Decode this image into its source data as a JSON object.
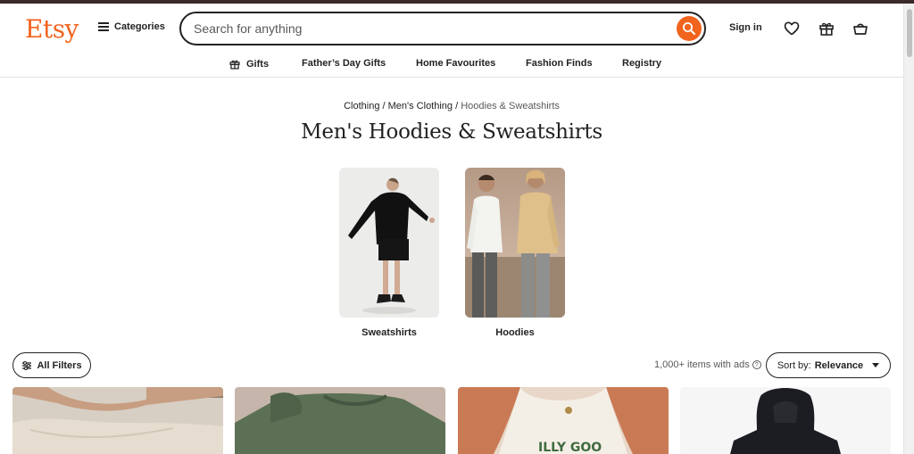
{
  "header": {
    "logo": "Etsy",
    "categories_label": "Categories",
    "search_placeholder": "Search for anything",
    "signin_label": "Sign in",
    "icons": [
      "search-icon",
      "heart-icon",
      "gift-icon",
      "bag-icon"
    ],
    "accent_color": "#f1641e"
  },
  "nav": {
    "items": [
      {
        "label": "Gifts",
        "icon": "gift-icon"
      },
      {
        "label": "Father’s Day Gifts"
      },
      {
        "label": "Home Favourites"
      },
      {
        "label": "Fashion Finds"
      },
      {
        "label": "Registry"
      }
    ]
  },
  "breadcrumb": {
    "items": [
      "Clothing",
      "Men's Clothing"
    ],
    "separator": "/",
    "current": "Hoodies & Sweatshirts"
  },
  "page": {
    "title": "Men's Hoodies & Sweatshirts"
  },
  "subcategories": [
    {
      "label": "Sweatshirts"
    },
    {
      "label": "Hoodies"
    }
  ],
  "toolbar": {
    "filters_label": "All Filters",
    "results_text": "1,000+ items with ads",
    "sort_prefix": "Sort by:",
    "sort_value": "Relevance"
  }
}
